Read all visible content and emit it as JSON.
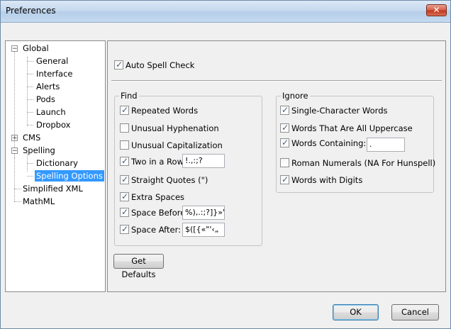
{
  "window": {
    "title": "Preferences",
    "close_glyph": "✕"
  },
  "tree": {
    "items": [
      {
        "label": "Global",
        "expander": "−"
      },
      {
        "label": "General"
      },
      {
        "label": "Interface"
      },
      {
        "label": "Alerts"
      },
      {
        "label": "Pods"
      },
      {
        "label": "Launch"
      },
      {
        "label": "Dropbox"
      },
      {
        "label": "CMS",
        "expander": "+"
      },
      {
        "label": "Spelling",
        "expander": "−"
      },
      {
        "label": "Dictionary"
      },
      {
        "label": "Spelling Options",
        "selected": true
      },
      {
        "label": "Simplified XML"
      },
      {
        "label": "MathML"
      }
    ]
  },
  "options": {
    "auto_spell_check": {
      "label": "Auto Spell Check",
      "checked": true
    },
    "find": {
      "title": "Find",
      "repeated_words": {
        "label": "Repeated Words",
        "checked": true
      },
      "unusual_hyphenation": {
        "label": "Unusual Hyphenation",
        "checked": false
      },
      "unusual_capitalization": {
        "label": "Unusual Capitalization",
        "checked": false
      },
      "two_in_a_row": {
        "label": "Two in a Row:",
        "checked": true,
        "value": "!.,:;?"
      },
      "straight_quotes": {
        "label": "Straight Quotes (\")",
        "checked": true
      },
      "extra_spaces": {
        "label": "Extra Spaces",
        "checked": true
      },
      "space_before": {
        "label": "Space Before:",
        "checked": true,
        "value": "%),.:;?]}»\"'›"
      },
      "space_after": {
        "label": "Space After:",
        "checked": true,
        "value": "$([{«\"'‹„"
      }
    },
    "ignore": {
      "title": "Ignore",
      "single_char": {
        "label": "Single-Character Words",
        "checked": true
      },
      "all_uppercase": {
        "label": "Words That Are All Uppercase",
        "checked": true
      },
      "containing": {
        "label": "Words Containing:",
        "checked": true,
        "value": "."
      },
      "roman_numerals": {
        "label": "Roman Numerals (NA For Hunspell)",
        "checked": false
      },
      "with_digits": {
        "label": "Words with Digits",
        "checked": true
      }
    },
    "get_defaults_label": "Get Defaults"
  },
  "footer": {
    "ok_label": "OK",
    "cancel_label": "Cancel"
  },
  "check_glyph": "✓",
  "colors": {
    "selection": "#3399ff",
    "title_bar": "#c4d8ee",
    "close_button": "#c2371e"
  }
}
